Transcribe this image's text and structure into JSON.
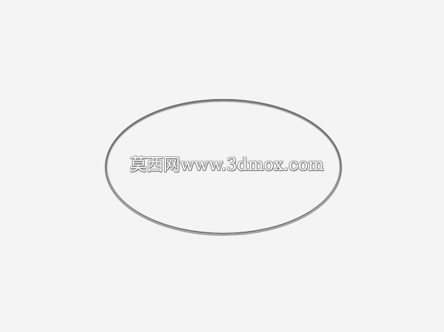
{
  "scene": {
    "background_color": "#f4f4f4",
    "ring_color": "#6e6e6e"
  },
  "watermark": {
    "text": "莫西网www.3dmox.com"
  }
}
